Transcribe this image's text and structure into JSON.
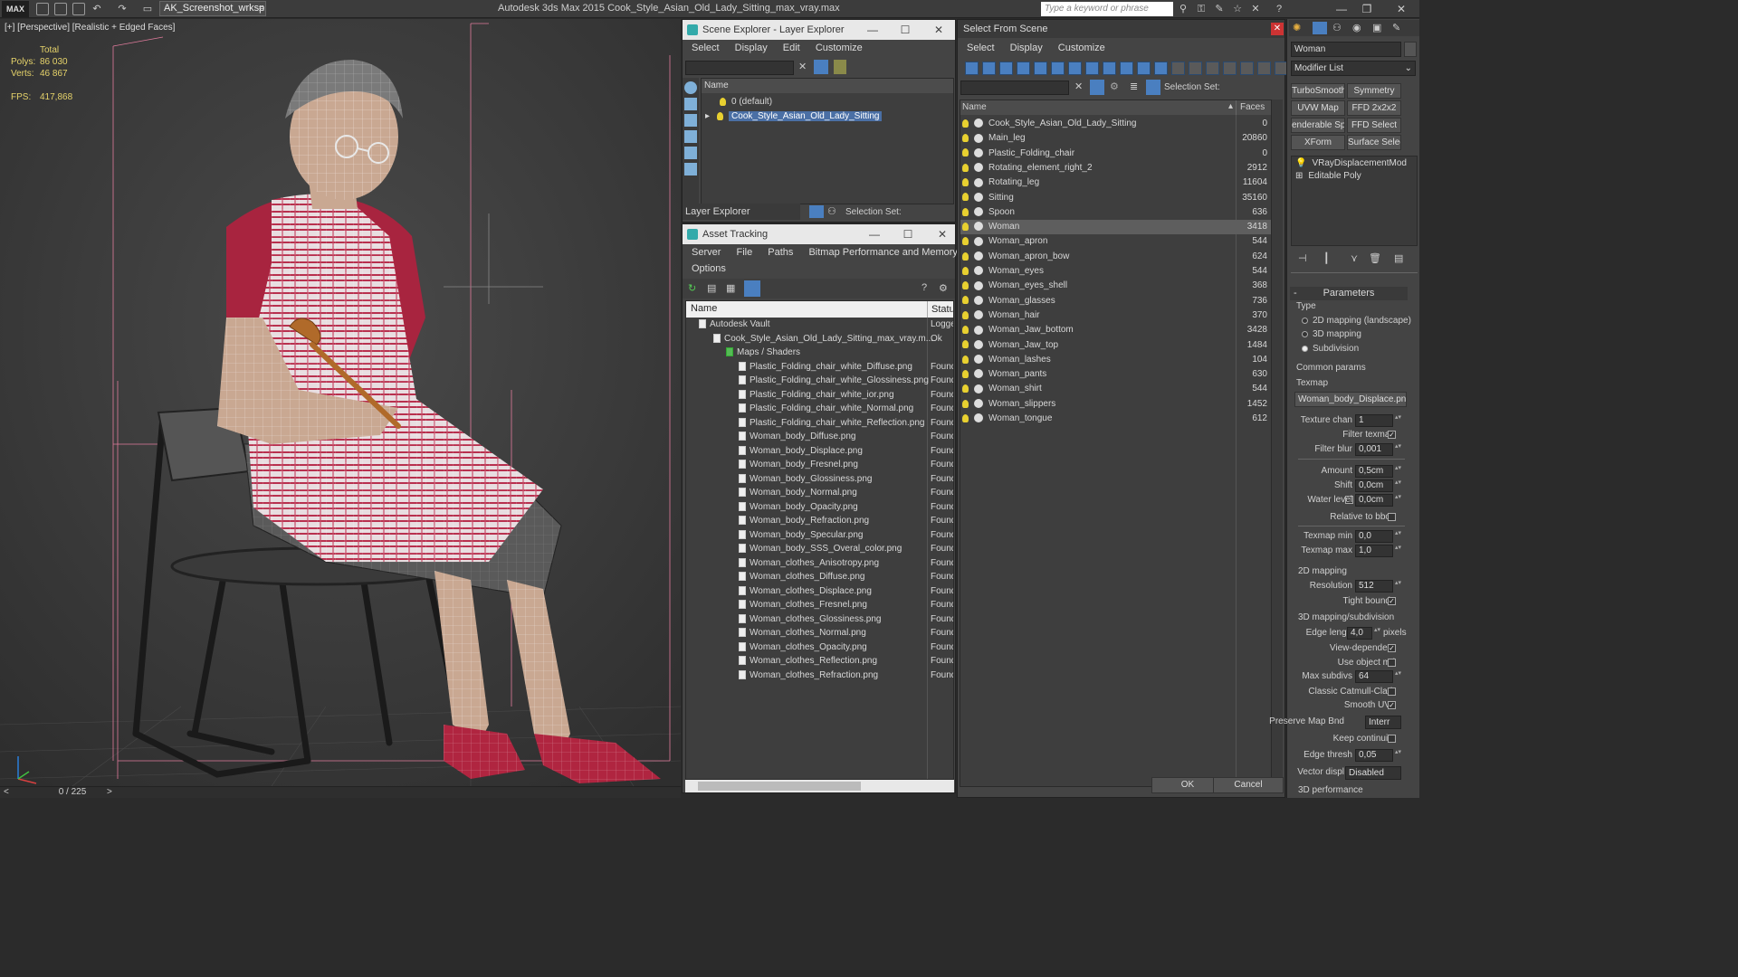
{
  "titlebar": {
    "logo": "MAX",
    "workspace": "AK_Screenshot_wrksp",
    "app_title": "Autodesk 3ds Max 2015    Cook_Style_Asian_Old_Lady_Sitting_max_vray.max",
    "search_placeholder": "Type a keyword or phrase"
  },
  "viewport": {
    "label": "[+] [Perspective] [Realistic + Edged Faces]",
    "stats": {
      "total_label": "Total",
      "polys_label": "Polys:",
      "polys": "86 030",
      "verts_label": "Verts:",
      "verts": "46 867",
      "fps_label": "FPS:",
      "fps": "417,868"
    },
    "frame": "0 / 225"
  },
  "scene_explorer": {
    "title": "Scene Explorer - Layer Explorer",
    "menu": [
      "Select",
      "Display",
      "Edit",
      "Customize"
    ],
    "col_name": "Name",
    "layers": [
      "0 (default)",
      "Cook_Style_Asian_Old_Lady_Sitting"
    ],
    "footer_dropdown": "Layer Explorer",
    "selection_set_label": "Selection Set:"
  },
  "asset_tracking": {
    "title": "Asset Tracking",
    "menu": [
      "Server",
      "File",
      "Paths",
      "Bitmap Performance and Memory"
    ],
    "menu2": "Options",
    "col_name": "Name",
    "col_status": "Status",
    "rows": [
      {
        "name": "Autodesk Vault",
        "status": "Logge"
      },
      {
        "name": "Cook_Style_Asian_Old_Lady_Sitting_max_vray.m...",
        "status": "Ok"
      },
      {
        "name": "Maps / Shaders",
        "status": ""
      },
      {
        "name": "Plastic_Folding_chair_white_Diffuse.png",
        "status": "Found"
      },
      {
        "name": "Plastic_Folding_chair_white_Glossiness.png",
        "status": "Found"
      },
      {
        "name": "Plastic_Folding_chair_white_ior.png",
        "status": "Found"
      },
      {
        "name": "Plastic_Folding_chair_white_Normal.png",
        "status": "Found"
      },
      {
        "name": "Plastic_Folding_chair_white_Reflection.png",
        "status": "Found"
      },
      {
        "name": "Woman_body_Diffuse.png",
        "status": "Found"
      },
      {
        "name": "Woman_body_Displace.png",
        "status": "Found"
      },
      {
        "name": "Woman_body_Fresnel.png",
        "status": "Found"
      },
      {
        "name": "Woman_body_Glossiness.png",
        "status": "Found"
      },
      {
        "name": "Woman_body_Normal.png",
        "status": "Found"
      },
      {
        "name": "Woman_body_Opacity.png",
        "status": "Found"
      },
      {
        "name": "Woman_body_Refraction.png",
        "status": "Found"
      },
      {
        "name": "Woman_body_Specular.png",
        "status": "Found"
      },
      {
        "name": "Woman_body_SSS_Overal_color.png",
        "status": "Found"
      },
      {
        "name": "Woman_clothes_Anisotropy.png",
        "status": "Found"
      },
      {
        "name": "Woman_clothes_Diffuse.png",
        "status": "Found"
      },
      {
        "name": "Woman_clothes_Displace.png",
        "status": "Found"
      },
      {
        "name": "Woman_clothes_Fresnel.png",
        "status": "Found"
      },
      {
        "name": "Woman_clothes_Glossiness.png",
        "status": "Found"
      },
      {
        "name": "Woman_clothes_Normal.png",
        "status": "Found"
      },
      {
        "name": "Woman_clothes_Opacity.png",
        "status": "Found"
      },
      {
        "name": "Woman_clothes_Reflection.png",
        "status": "Found"
      },
      {
        "name": "Woman_clothes_Refraction.png",
        "status": "Found"
      }
    ]
  },
  "select_from_scene": {
    "title": "Select From Scene",
    "menu": [
      "Select",
      "Display",
      "Customize"
    ],
    "selection_set_label": "Selection Set:",
    "col_name": "Name",
    "col_faces": "Faces",
    "rows": [
      {
        "name": "Cook_Style_Asian_Old_Lady_Sitting",
        "faces": "0"
      },
      {
        "name": "Main_leg",
        "faces": "20860"
      },
      {
        "name": "Plastic_Folding_chair",
        "faces": "0"
      },
      {
        "name": "Rotating_element_right_2",
        "faces": "2912"
      },
      {
        "name": "Rotating_leg",
        "faces": "11604"
      },
      {
        "name": "Sitting",
        "faces": "35160"
      },
      {
        "name": "Spoon",
        "faces": "636"
      },
      {
        "name": "Woman",
        "faces": "3418"
      },
      {
        "name": "Woman_apron",
        "faces": "544"
      },
      {
        "name": "Woman_apron_bow",
        "faces": "624"
      },
      {
        "name": "Woman_eyes",
        "faces": "544"
      },
      {
        "name": "Woman_eyes_shell",
        "faces": "368"
      },
      {
        "name": "Woman_glasses",
        "faces": "736"
      },
      {
        "name": "Woman_hair",
        "faces": "370"
      },
      {
        "name": "Woman_Jaw_bottom",
        "faces": "3428"
      },
      {
        "name": "Woman_Jaw_top",
        "faces": "1484"
      },
      {
        "name": "Woman_lashes",
        "faces": "104"
      },
      {
        "name": "Woman_pants",
        "faces": "630"
      },
      {
        "name": "Woman_shirt",
        "faces": "544"
      },
      {
        "name": "Woman_slippers",
        "faces": "1452"
      },
      {
        "name": "Woman_tongue",
        "faces": "612"
      }
    ],
    "ok": "OK",
    "cancel": "Cancel"
  },
  "command_panel": {
    "object_name": "Woman",
    "modifier_list": "Modifier List",
    "modifier_buttons": [
      "TurboSmooth",
      "Symmetry",
      "UVW Map",
      "FFD 2x2x2",
      "enderable Splir",
      "FFD Select",
      "XForm",
      "Surface Select"
    ],
    "stack": [
      "VRayDisplacementMod",
      "Editable Poly"
    ],
    "params_title": "Parameters",
    "type_label": "Type",
    "types": [
      "2D mapping (landscape)",
      "3D mapping",
      "Subdivision"
    ],
    "common_params": "Common params",
    "texmap_label": "Texmap",
    "texmap": "Woman_body_Displace.png)",
    "texture_chan_label": "Texture chan",
    "texture_chan": "1",
    "filter_texmap": "Filter texmap",
    "filter_blur_label": "Filter blur",
    "filter_blur": "0,001",
    "amount_label": "Amount",
    "amount": "0,5cm",
    "shift_label": "Shift",
    "shift": "0,0cm",
    "water_level_label": "Water level",
    "water_level": "0,0cm",
    "relative_bbox": "Relative to bbox",
    "texmap_min_label": "Texmap min",
    "texmap_min": "0,0",
    "texmap_max_label": "Texmap max",
    "texmap_max": "1,0",
    "mapping2d": "2D mapping",
    "resolution_label": "Resolution",
    "resolution": "512",
    "tight_bounds": "Tight bounds",
    "mapping3d": "3D mapping/subdivision",
    "edge_length_label": "Edge length",
    "edge_length": "4,0",
    "pixels": "pixels",
    "view_dependent": "View-dependent",
    "use_object_mtl": "Use object mtl",
    "max_subdivs_label": "Max subdivs",
    "max_subdivs": "64",
    "classic_cc": "Classic Catmull-Clark",
    "smooth_uvs": "Smooth UVs",
    "preserve_map_label": "Preserve Map Bnd",
    "preserve_map": "Interr",
    "keep_continuity": "Keep continuity",
    "edge_thresh_label": "Edge thresh",
    "edge_thresh": "0,05",
    "vector_displ_label": "Vector displ",
    "vector_displ": "Disabled",
    "perf": "3D performance"
  }
}
